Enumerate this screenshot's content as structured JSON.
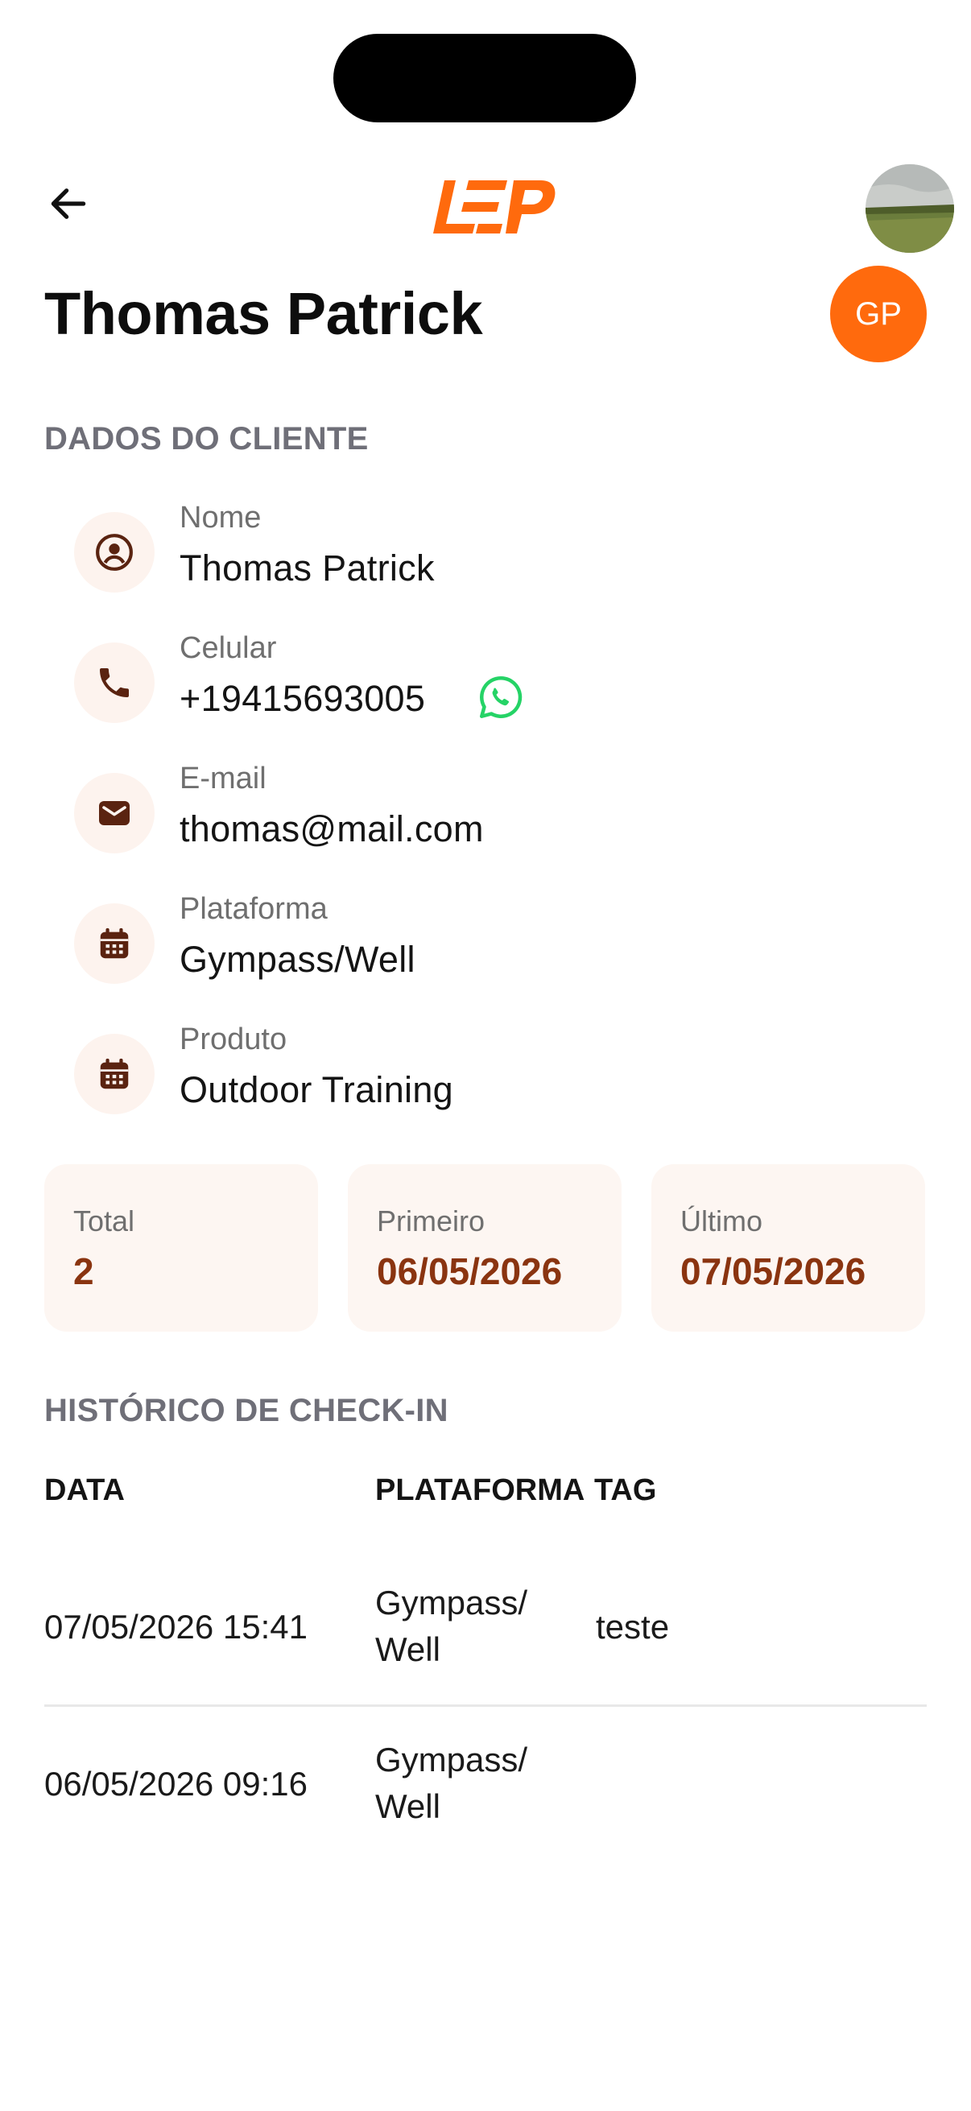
{
  "header": {
    "logo_text": "LEP",
    "title": "Thomas Patrick",
    "avatar_initials": "GP"
  },
  "client_section": {
    "heading": "DADOS DO CLIENTE",
    "fields": [
      {
        "label": "Nome",
        "value": "Thomas Patrick",
        "icon": "user-circle-icon"
      },
      {
        "label": "Celular",
        "value": "+19415693005",
        "icon": "phone-icon"
      },
      {
        "label": "E-mail",
        "value": "thomas@mail.com",
        "icon": "envelope-icon"
      },
      {
        "label": "Plataforma",
        "value": "Gympass/Well",
        "icon": "calendar-icon"
      },
      {
        "label": "Produto",
        "value": "Outdoor Training",
        "icon": "calendar-icon"
      }
    ]
  },
  "stats": [
    {
      "label": "Total",
      "value": "2"
    },
    {
      "label": "Primeiro",
      "value": "06/05/2026"
    },
    {
      "label": "Último",
      "value": "07/05/2026"
    }
  ],
  "history": {
    "heading": "HISTÓRICO DE CHECK-IN",
    "columns": [
      "DATA",
      "PLATAFORMA",
      "TAG"
    ],
    "rows": [
      {
        "date": "07/05/2026 15:41",
        "platform_line1": "Gympass/",
        "platform_line2": "Well",
        "tag": "teste"
      },
      {
        "date": "06/05/2026 09:16",
        "platform_line1": "Gympass/",
        "platform_line2": "Well",
        "tag": ""
      }
    ]
  },
  "colors": {
    "accent": "#ff6a0d",
    "stat_value": "#8a3410",
    "icon_bg": "#fdf3ee",
    "whatsapp": "#25d366"
  }
}
